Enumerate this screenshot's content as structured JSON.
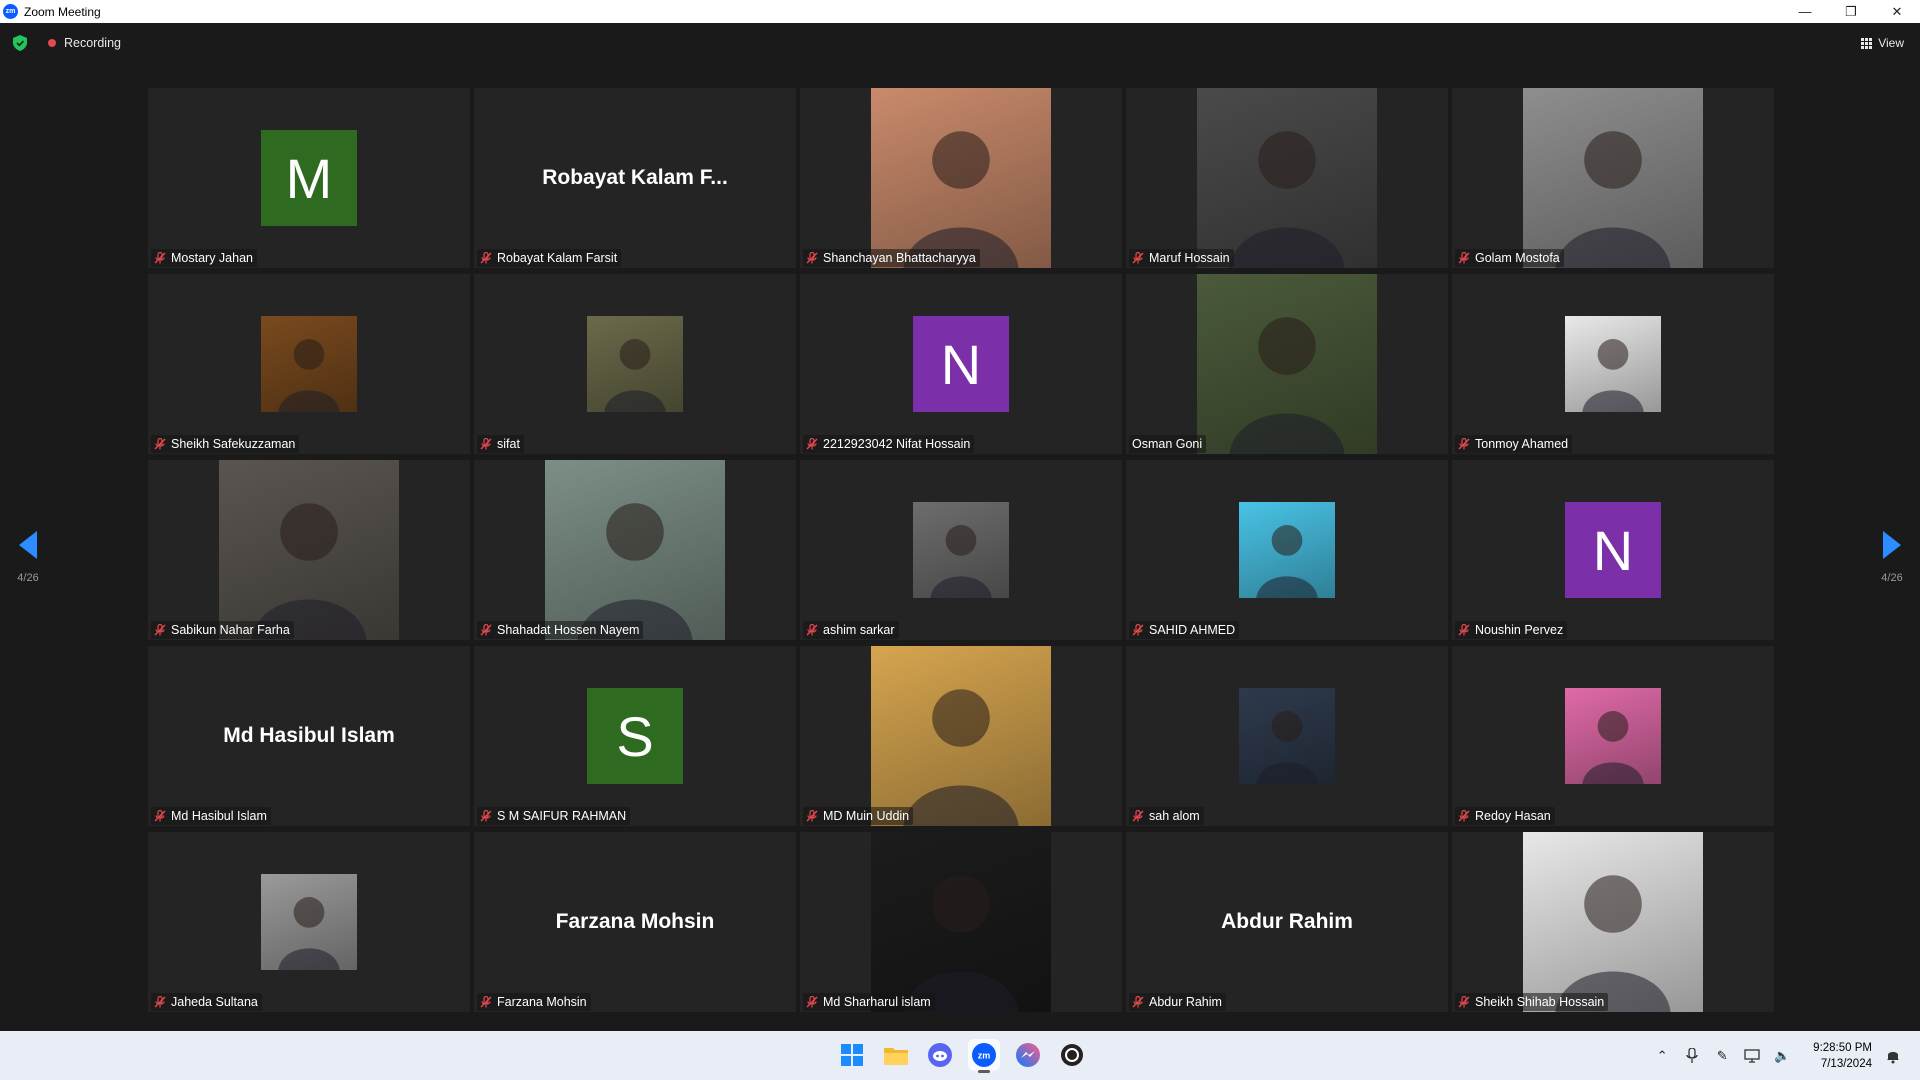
{
  "window": {
    "title": "Zoom Meeting",
    "app_icon": "zm"
  },
  "topbar": {
    "recording_label": "Recording",
    "view_label": "View"
  },
  "pager": {
    "left_text": "4/26",
    "right_text": "4/26"
  },
  "tiles": [
    {
      "name": "Mostary Jahan",
      "kind": "letter",
      "letter": "M",
      "color": "#2e6b21"
    },
    {
      "name": "Robayat Kalam Farsit",
      "kind": "bigname",
      "display": "Robayat Kalam F..."
    },
    {
      "name": "Shanchayan Bhattacharyya",
      "kind": "photo",
      "color": "#c98a6b"
    },
    {
      "name": "Maruf Hossain",
      "kind": "photo",
      "color": "#4a4a4a"
    },
    {
      "name": "Golam Mostofa",
      "kind": "photo",
      "color": "#8e8e8e"
    },
    {
      "name": "Sheikh Safekuzzaman",
      "kind": "small",
      "color": "#7a4a1e"
    },
    {
      "name": "sifat",
      "kind": "small",
      "color": "#6b6a4a"
    },
    {
      "name": "2212923042 Nifat Hossain",
      "kind": "letter",
      "letter": "N",
      "color": "#7b2fa8"
    },
    {
      "name": "Osman Goni",
      "kind": "photo",
      "color": "#4b5a3a",
      "unmuted": true
    },
    {
      "name": "Tonmoy Ahamed",
      "kind": "small",
      "color": "#e9e9e9"
    },
    {
      "name": "Sabikun Nahar Farha",
      "kind": "photo",
      "color": "#5a5550"
    },
    {
      "name": "Shahadat Hossen Nayem",
      "kind": "photo",
      "color": "#7c8f86"
    },
    {
      "name": "ashim sarkar",
      "kind": "small",
      "color": "#6d6d6d"
    },
    {
      "name": "SAHID AHMED",
      "kind": "small",
      "color": "#49c3e6"
    },
    {
      "name": "Noushin Pervez",
      "kind": "letter",
      "letter": "N",
      "color": "#7b2fa8"
    },
    {
      "name": "Md Hasibul Islam",
      "kind": "bigname",
      "display": "Md Hasibul Islam"
    },
    {
      "name": "S M SAIFUR RAHMAN",
      "kind": "letter",
      "letter": "S",
      "color": "#2e6b21"
    },
    {
      "name": "MD Muin Uddin",
      "kind": "photo",
      "color": "#d6a54f"
    },
    {
      "name": "sah alom",
      "kind": "small",
      "color": "#2e3a4c"
    },
    {
      "name": "Redoy Hasan",
      "kind": "small",
      "color": "#e06aa8"
    },
    {
      "name": "Jaheda Sultana",
      "kind": "small",
      "color": "#9a9a9a"
    },
    {
      "name": "Farzana Mohsin",
      "kind": "bigname",
      "display": "Farzana Mohsin"
    },
    {
      "name": "Md Sharharul islam",
      "kind": "photo",
      "color": "#1c1c1c"
    },
    {
      "name": "Abdur Rahim",
      "kind": "bigname",
      "display": "Abdur Rahim"
    },
    {
      "name": "Sheikh Shihab Hossain",
      "kind": "photo",
      "color": "#e8e8e8"
    }
  ],
  "taskbar": {
    "apps": [
      "windows-start-icon",
      "file-explorer-icon",
      "discord-icon",
      "zoom-icon",
      "messenger-icon",
      "chatgpt-icon"
    ],
    "time": "9:28:50 PM",
    "date": "7/13/2024"
  },
  "colors": {
    "accent": "#2d8cff",
    "recording": "#e5484d",
    "muted_mic": "#e5484d"
  }
}
